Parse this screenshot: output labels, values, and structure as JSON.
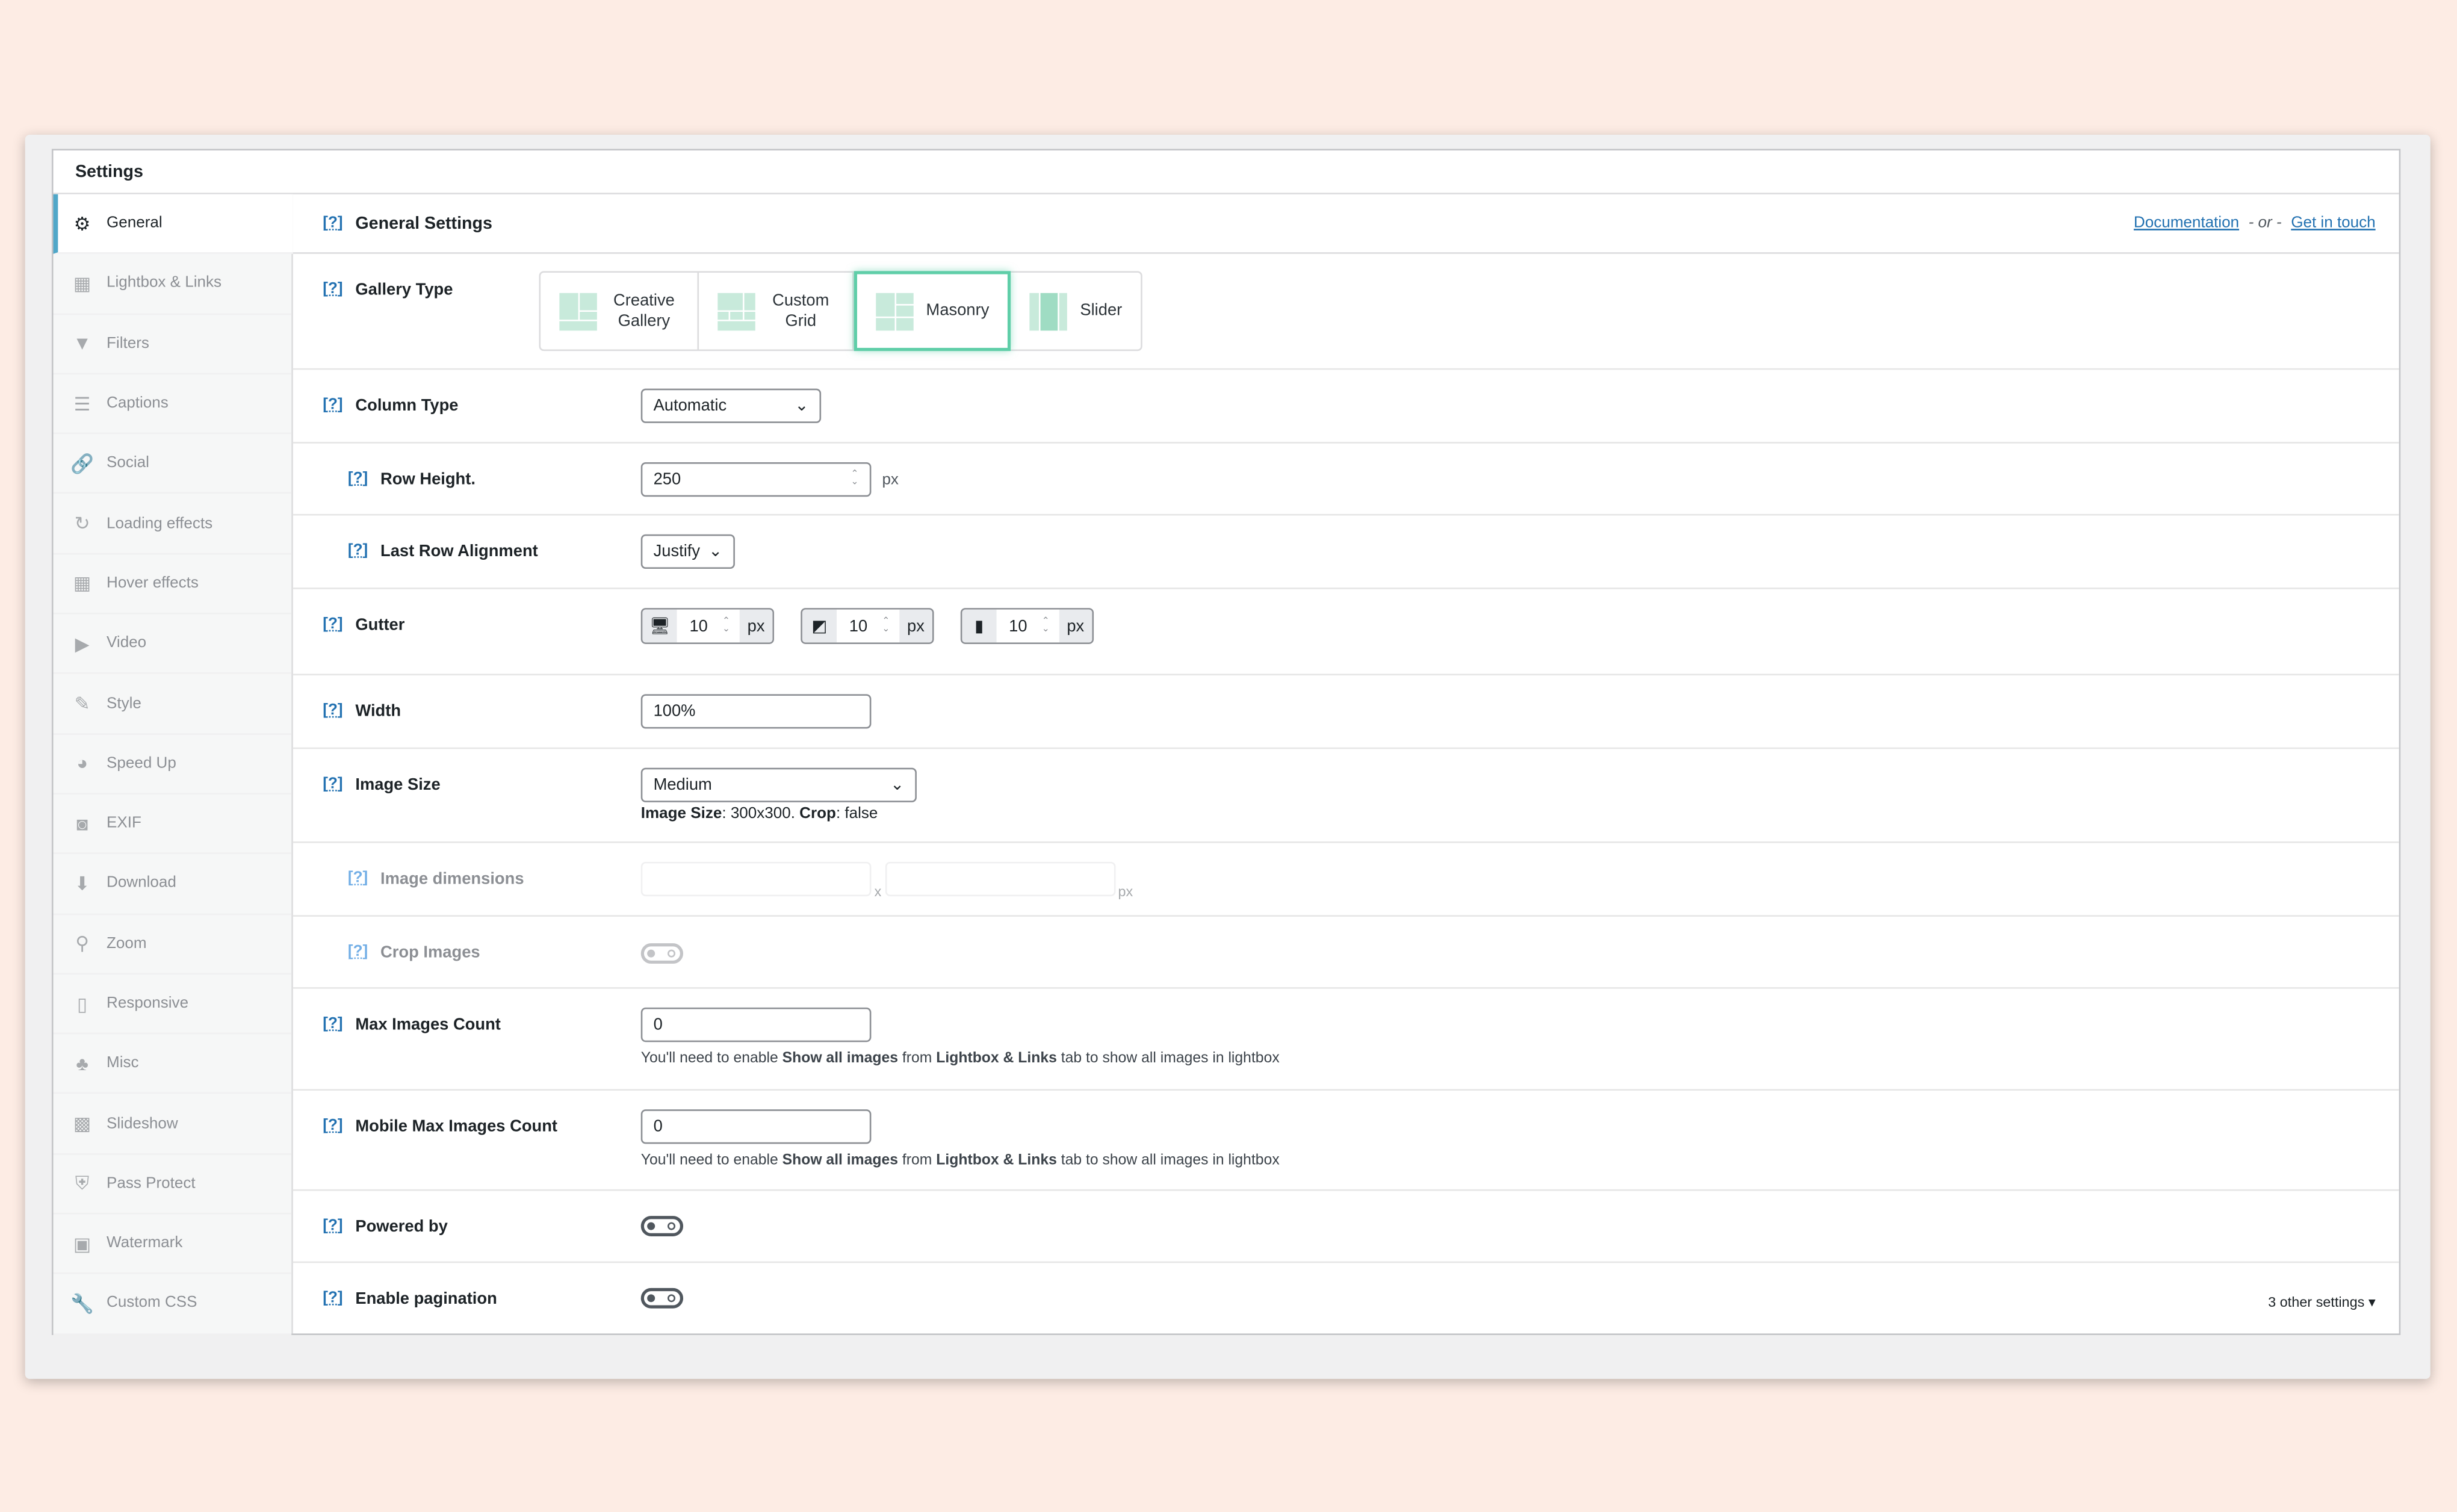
{
  "panel_title": "Settings",
  "sidebar": {
    "items": [
      {
        "label": "General",
        "icon": "gear-icon",
        "glyph": "⚙",
        "active": true
      },
      {
        "label": "Lightbox & Links",
        "icon": "layout-icon",
        "glyph": "▦"
      },
      {
        "label": "Filters",
        "icon": "filter-icon",
        "glyph": "▼"
      },
      {
        "label": "Captions",
        "icon": "captions-icon",
        "glyph": "☰"
      },
      {
        "label": "Social",
        "icon": "link-icon",
        "glyph": "🔗"
      },
      {
        "label": "Loading effects",
        "icon": "refresh-icon",
        "glyph": "↻"
      },
      {
        "label": "Hover effects",
        "icon": "layout-icon",
        "glyph": "▦"
      },
      {
        "label": "Video",
        "icon": "video-icon",
        "glyph": "▶"
      },
      {
        "label": "Style",
        "icon": "brush-icon",
        "glyph": "✎"
      },
      {
        "label": "Speed Up",
        "icon": "dashboard-icon",
        "glyph": "◕"
      },
      {
        "label": "EXIF",
        "icon": "camera-icon",
        "glyph": "◙"
      },
      {
        "label": "Download",
        "icon": "download-icon",
        "glyph": "⬇"
      },
      {
        "label": "Zoom",
        "icon": "search-icon",
        "glyph": "⚲"
      },
      {
        "label": "Responsive",
        "icon": "phone-icon",
        "glyph": "▯"
      },
      {
        "label": "Misc",
        "icon": "groups-icon",
        "glyph": "♣"
      },
      {
        "label": "Slideshow",
        "icon": "images-icon",
        "glyph": "▩"
      },
      {
        "label": "Pass Protect",
        "icon": "shield-icon",
        "glyph": "⛨"
      },
      {
        "label": "Watermark",
        "icon": "image-icon",
        "glyph": "▣"
      },
      {
        "label": "Custom CSS",
        "icon": "wrench-icon",
        "glyph": "🔧"
      }
    ]
  },
  "header": {
    "help": "[?]",
    "title": "General Settings",
    "doc_link": "Documentation",
    "or": "- or -",
    "contact_link": "Get in touch"
  },
  "fields": {
    "gallery_type": {
      "label": "Gallery Type",
      "options": [
        "Creative Gallery",
        "Custom Grid",
        "Masonry",
        "Slider"
      ],
      "selected": "Masonry"
    },
    "column_type": {
      "label": "Column Type",
      "value": "Automatic"
    },
    "row_height": {
      "label": "Row Height.",
      "value": "250",
      "unit": "px"
    },
    "last_row": {
      "label": "Last Row Alignment",
      "value": "Justify"
    },
    "gutter": {
      "label": "Gutter",
      "desktop": "10",
      "tablet": "10",
      "mobile": "10",
      "unit": "px"
    },
    "width": {
      "label": "Width",
      "value": "100%"
    },
    "image_size": {
      "label": "Image Size",
      "value": "Medium",
      "note_label": "Image Size",
      "note_value": ": 300x300. ",
      "crop_label": "Crop",
      "crop_value": ": false"
    },
    "image_dimensions": {
      "label": "Image dimensions",
      "x": "x",
      "unit": "px"
    },
    "crop_images": {
      "label": "Crop Images",
      "on": false
    },
    "max_images": {
      "label": "Max Images Count",
      "value": "0",
      "note_a": "You'll need to enable ",
      "note_b": "Show all images",
      "note_c": " from ",
      "note_d": "Lightbox & Links",
      "note_e": " tab to show all images in lightbox"
    },
    "mobile_max_images": {
      "label": "Mobile Max Images Count",
      "value": "0",
      "note_a": "You'll need to enable ",
      "note_b": "Show all images",
      "note_c": " from ",
      "note_d": "Lightbox & Links",
      "note_e": " tab to show all images in lightbox"
    },
    "powered_by": {
      "label": "Powered by",
      "on": false
    },
    "pagination": {
      "label": "Enable pagination",
      "on": false
    }
  },
  "other_settings": "3 other settings ▾",
  "colors": {
    "accent": "#2271b1",
    "selected_border": "#5fcea8",
    "active_tab": "#50a7c8",
    "background": "#fdece4"
  }
}
